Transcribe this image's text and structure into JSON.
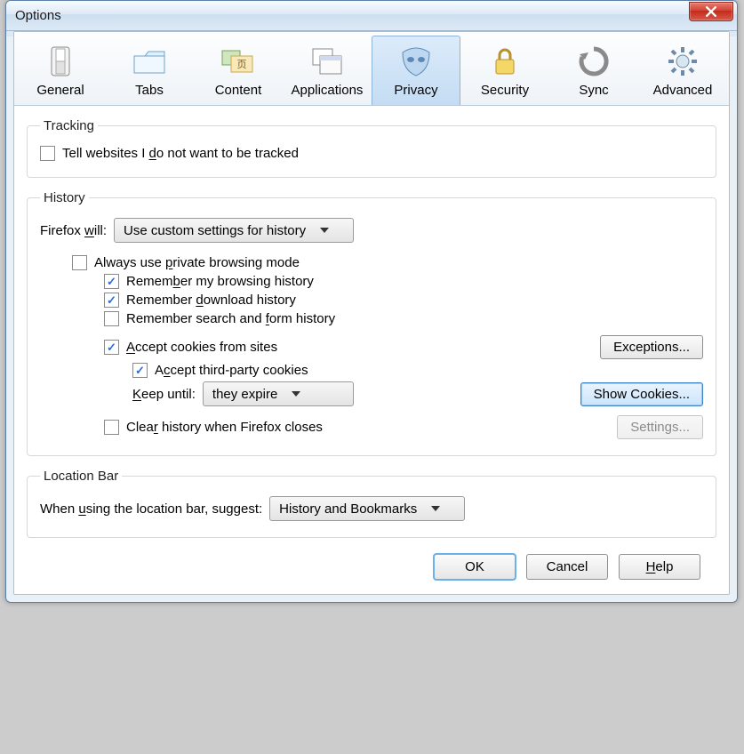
{
  "window": {
    "title": "Options"
  },
  "tabs": [
    {
      "label": "General"
    },
    {
      "label": "Tabs"
    },
    {
      "label": "Content"
    },
    {
      "label": "Applications"
    },
    {
      "label": "Privacy",
      "selected": true
    },
    {
      "label": "Security"
    },
    {
      "label": "Sync"
    },
    {
      "label": "Advanced"
    }
  ],
  "tracking": {
    "legend": "Tracking",
    "dnt_pre": "Tell websites I ",
    "dnt_u": "d",
    "dnt_post": "o not want to be tracked",
    "dnt_checked": false
  },
  "history": {
    "legend": "History",
    "firefox_will_pre": "Firefox ",
    "firefox_will_u": "w",
    "firefox_will_post": "ill:",
    "mode": "Use custom settings for history",
    "always_private_pre": "Always use ",
    "always_private_u": "p",
    "always_private_post": "rivate browsing mode",
    "always_private_checked": false,
    "remember_browsing_pre": "Remem",
    "remember_browsing_u": "b",
    "remember_browsing_post": "er my browsing history",
    "remember_browsing_checked": true,
    "remember_download_pre": "Remember ",
    "remember_download_u": "d",
    "remember_download_post": "ownload history",
    "remember_download_checked": true,
    "remember_form_pre": "Remember search and ",
    "remember_form_u": "f",
    "remember_form_post": "orm history",
    "remember_form_checked": false,
    "accept_cookies_u": "A",
    "accept_cookies_post": "ccept cookies from sites",
    "accept_cookies_checked": true,
    "exceptions": "Exceptions...",
    "accept_third_pre": "A",
    "accept_third_u": "c",
    "accept_third_post": "cept third-party cookies",
    "accept_third_checked": true,
    "keep_until_u": "K",
    "keep_until_post": "eep until:",
    "keep_until_value": "they expire",
    "show_cookies": "Show Cookies...",
    "clear_history_pre": "Clea",
    "clear_history_u": "r",
    "clear_history_post": " history when Firefox closes",
    "clear_history_checked": false,
    "settings": "Settings..."
  },
  "location": {
    "legend": "Location Bar",
    "label_pre": "When ",
    "label_u": "u",
    "label_post": "sing the location bar, suggest:",
    "value": "History and Bookmarks"
  },
  "footer": {
    "ok": "OK",
    "cancel": "Cancel",
    "help_u": "H",
    "help_post": "elp"
  }
}
